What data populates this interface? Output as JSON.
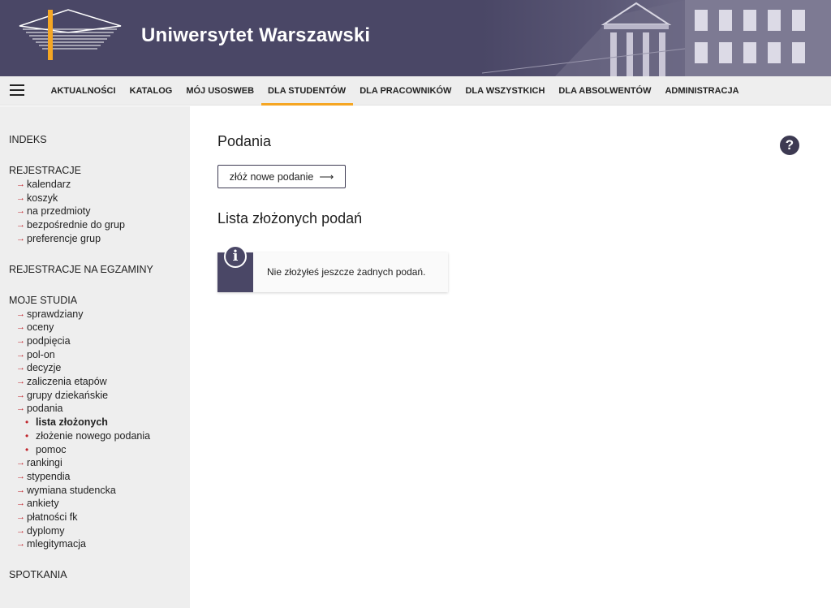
{
  "header": {
    "title": "Uniwersytet Warszawski",
    "bg_color": "#4a4766",
    "logo_icon": "university-logo-icon"
  },
  "nav": {
    "items": [
      {
        "label": "AKTUALNOŚCI"
      },
      {
        "label": "KATALOG"
      },
      {
        "label": "MÓJ USOSWEB"
      },
      {
        "label": "DLA STUDENTÓW",
        "active": true
      },
      {
        "label": "DLA PRACOWNIKÓW"
      },
      {
        "label": "DLA WSZYSTKICH"
      },
      {
        "label": "DLA ABSOLWENTÓW"
      },
      {
        "label": "ADMINISTRACJA"
      }
    ],
    "active_color": "#f5a623"
  },
  "sidebar": {
    "indeks": "INDEKS",
    "rejestracje": {
      "head": "REJESTRACJE",
      "items": [
        "kalendarz",
        "koszyk",
        "na przedmioty",
        "bezpośrednie do grup",
        "preferencje grup"
      ]
    },
    "egzaminy": "REJESTRACJE NA EGZAMINY",
    "moje_studia": {
      "head": "MOJE STUDIA",
      "items": [
        "sprawdziany",
        "oceny",
        "podpięcia",
        "pol-on",
        "decyzje",
        "zaliczenia etapów",
        "grupy dziekańskie",
        "podania"
      ],
      "podania_sub": [
        "lista złożonych",
        "złożenie nowego podania",
        "pomoc"
      ],
      "items_after": [
        "rankingi",
        "stypendia",
        "wymiana studencka",
        "ankiety",
        "płatności fk",
        "dyplomy",
        "mlegitymacja"
      ]
    },
    "spotkania": "SPOTKANIA",
    "arrow_glyph": "→",
    "dot_glyph": "•"
  },
  "main": {
    "title": "Podania",
    "help_glyph": "?",
    "new_button": "złóż nowe podanie",
    "new_button_arrow": "⟶",
    "list_title": "Lista złożonych podań",
    "info_glyph": "i",
    "info_message": "Nie złożyłeś jeszcze żadnych podań."
  }
}
